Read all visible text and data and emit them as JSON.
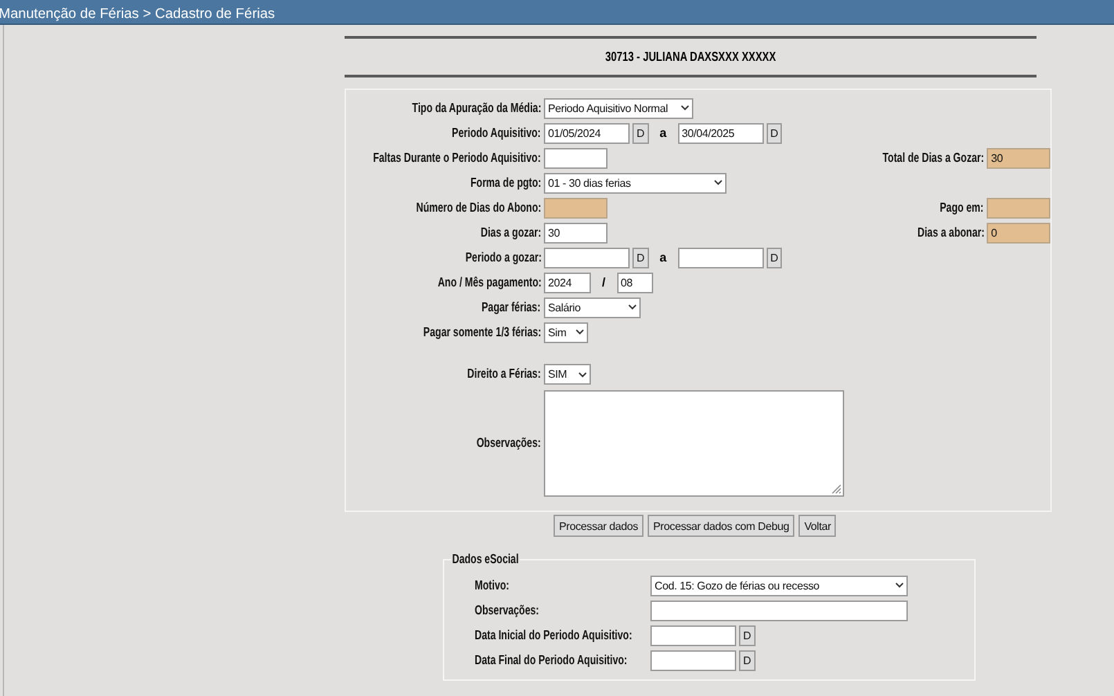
{
  "title_bar": {
    "breadcrumb": "Manutenção de Férias > Cadastro de Férias"
  },
  "employee": {
    "name": "30713 - JULIANA DAXSXXX XXXXX"
  },
  "form": {
    "rows": [
      {
        "label": "Tipo da Apuração da Média:",
        "controls": [
          {
            "kind": "select",
            "value": "Periodo Aquisitivo Normal"
          }
        ]
      },
      {
        "label": "Periodo Aquisitivo:",
        "controls": [
          {
            "kind": "date",
            "value": "01/05/2024"
          },
          {
            "kind": "button",
            "label": "D"
          },
          {
            "kind": "sep",
            "text": "a"
          },
          {
            "kind": "date",
            "value": "30/04/2025"
          },
          {
            "kind": "button",
            "label": "D"
          }
        ]
      },
      {
        "label": "Faltas Durante o Periodo Aquisitivo:",
        "controls": [
          {
            "kind": "short",
            "disabled": false
          }
        ],
        "right": {
          "label": "Total de Dias a Gozar:",
          "value": "30",
          "disabled": true
        }
      },
      {
        "label": "Forma de pgto:",
        "controls": [
          {
            "kind": "select",
            "value": "01 - 30 dias ferias"
          }
        ]
      },
      {
        "label": "Número de Dias do Abono:",
        "controls": [
          {
            "kind": "short",
            "disabled": true
          }
        ],
        "right": {
          "label": "Pago em:",
          "disabled": true
        }
      },
      {
        "label": "Dias a gozar:",
        "controls": [
          {
            "kind": "short",
            "value": "30",
            "disabled": false
          }
        ],
        "right": {
          "label": "Dias a abonar:",
          "value": "0",
          "disabled": true
        }
      },
      {
        "label": "Periodo a gozar:",
        "controls": [
          {
            "kind": "date"
          },
          {
            "kind": "button",
            "label": "D"
          },
          {
            "kind": "sep",
            "text": "a"
          },
          {
            "kind": "date"
          },
          {
            "kind": "button",
            "label": "D"
          }
        ]
      },
      {
        "label": "Ano / Mês pagamento:",
        "controls": [
          {
            "kind": "year",
            "value": "2024"
          },
          {
            "kind": "sep",
            "text": "/"
          },
          {
            "kind": "month",
            "value": "08"
          }
        ]
      },
      {
        "label": "Pagar férias:",
        "controls": [
          {
            "kind": "select",
            "value": "Salário"
          }
        ]
      },
      {
        "label": "Pagar somente 1/3 férias:",
        "controls": [
          {
            "kind": "select",
            "value": "Sim"
          }
        ]
      },
      {
        "label": "Direito a Férias:",
        "controls": [
          {
            "kind": "select",
            "value": "SIM"
          }
        ]
      },
      {
        "label": "Observações:",
        "controls": [
          {
            "kind": "textarea"
          }
        ]
      }
    ]
  },
  "actions": [
    "Processar dados",
    "Processar dados com Debug",
    "Voltar"
  ],
  "esocial": {
    "legend": "Dados eSocial",
    "rows": [
      {
        "label": "Motivo:",
        "controls": [
          {
            "kind": "select",
            "value": "Cod. 15: Gozo de férias ou recesso"
          }
        ]
      },
      {
        "label": "Observações:",
        "controls": [
          {
            "kind": "wide"
          }
        ]
      },
      {
        "label": "Data Inicial do Periodo Aquisitivo:",
        "controls": [
          {
            "kind": "date"
          },
          {
            "kind": "button",
            "label": "D"
          }
        ]
      },
      {
        "label": "Data Final do Periodo Aquisitivo:",
        "controls": [
          {
            "kind": "date"
          },
          {
            "kind": "button",
            "label": "D"
          }
        ]
      }
    ]
  }
}
